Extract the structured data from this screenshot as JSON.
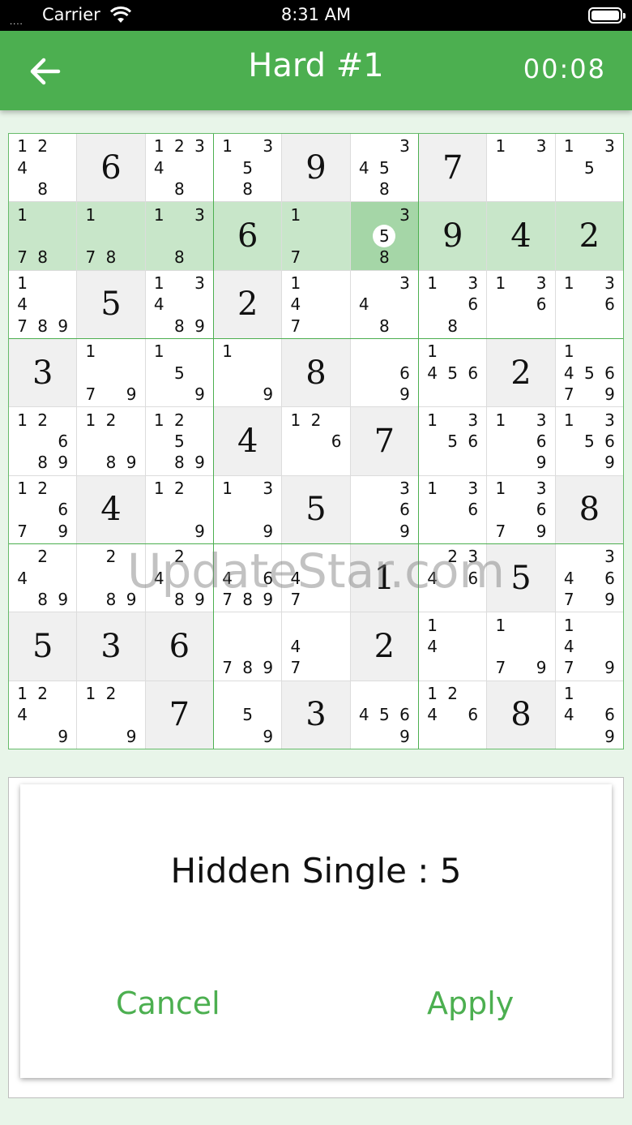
{
  "status_bar": {
    "signal": "....",
    "carrier": "Carrier",
    "time": "8:31 AM"
  },
  "app_bar": {
    "title": "Hard #1",
    "timer": "00:08"
  },
  "board": {
    "cells": [
      [
        {
          "n": "1 2 _ 4 _ _ _ 8 _"
        },
        {
          "v": "6",
          "g": 1
        },
        {
          "n": "1 2 3 4 _ _ _ 8 _"
        },
        {
          "n": "1 _ 3 _ 5 _ _ 8 _"
        },
        {
          "v": "9",
          "g": 1
        },
        {
          "n": "_ _ 3 4 5 _ _ 8 _"
        },
        {
          "v": "7",
          "g": 1
        },
        {
          "n": "1 _ 3 _ _ _ _ _ _"
        },
        {
          "n": "1 _ 3 _ 5 _ _ _ _"
        }
      ],
      [
        {
          "n": "1 _ _ _ _ _ 7 8 _",
          "h": 1
        },
        {
          "n": "1 _ _ _ _ _ 7 8 _",
          "h": 1
        },
        {
          "n": "1 _ 3 _ _ _ _ 8 _",
          "h": 1
        },
        {
          "v": "6",
          "h": 1
        },
        {
          "n": "1 _ _ _ _ _ 7 _ _",
          "h": 1
        },
        {
          "n": "_ _ 3 _ 5 _ _ 8 _",
          "s": 1,
          "m": "5"
        },
        {
          "v": "9",
          "h": 1
        },
        {
          "v": "4",
          "h": 1
        },
        {
          "v": "2",
          "h": 1
        }
      ],
      [
        {
          "n": "1 _ _ 4 _ _ 7 8 9"
        },
        {
          "v": "5",
          "g": 1
        },
        {
          "n": "1 _ 3 4 _ _ _ 8 9"
        },
        {
          "v": "2",
          "g": 1
        },
        {
          "n": "1 _ _ 4 _ _ 7 _ _"
        },
        {
          "n": "_ _ 3 4 _ _ _ 8 _"
        },
        {
          "n": "1 _ 3 _ _ 6 _ 8 _"
        },
        {
          "n": "1 _ 3 _ _ 6 _ _ _"
        },
        {
          "n": "1 _ 3 _ _ 6 _ _ _"
        }
      ],
      [
        {
          "v": "3",
          "g": 1
        },
        {
          "n": "1 _ _ _ _ _ 7 _ 9"
        },
        {
          "n": "1 _ _ _ 5 _ _ _ 9"
        },
        {
          "n": "1 _ _ _ _ _ _ _ 9"
        },
        {
          "v": "8",
          "g": 1
        },
        {
          "n": "_ _ _ _ _ 6 _ _ 9"
        },
        {
          "n": "1 _ _ 4 5 6 _ _ _"
        },
        {
          "v": "2",
          "g": 1
        },
        {
          "n": "1 _ _ 4 5 6 7 _ 9"
        }
      ],
      [
        {
          "n": "1 2 _ _ _ 6 _ 8 9"
        },
        {
          "n": "1 2 _ _ _ _ _ 8 9"
        },
        {
          "n": "1 2 _ _ 5 _ _ 8 9"
        },
        {
          "v": "4",
          "g": 1
        },
        {
          "n": "1 2 _ _ _ 6 _ _ _"
        },
        {
          "v": "7",
          "g": 1
        },
        {
          "n": "1 _ 3 _ 5 6 _ _ _"
        },
        {
          "n": "1 _ 3 _ _ 6 _ _ 9"
        },
        {
          "n": "1 _ 3 _ 5 6 _ _ 9"
        }
      ],
      [
        {
          "n": "1 2 _ _ _ 6 7 _ 9"
        },
        {
          "v": "4",
          "g": 1
        },
        {
          "n": "1 2 _ _ _ _ _ _ 9"
        },
        {
          "n": "1 _ 3 _ _ _ _ _ 9"
        },
        {
          "v": "5",
          "g": 1
        },
        {
          "n": "_ _ 3 _ _ 6 _ _ 9"
        },
        {
          "n": "1 _ 3 _ _ 6 _ _ _"
        },
        {
          "n": "1 _ 3 _ _ 6 7 _ 9"
        },
        {
          "v": "8",
          "g": 1
        }
      ],
      [
        {
          "n": "_ 2 _ 4 _ _ _ 8 9"
        },
        {
          "n": "_ 2 _ _ _ _ _ 8 9"
        },
        {
          "n": "_ 2 _ 4 _ _ _ 8 9"
        },
        {
          "n": "_ _ _ 4 _ 6 7 8 9"
        },
        {
          "n": "_ _ _ 4 _ _ 7 _ _"
        },
        {
          "v": "1",
          "g": 1
        },
        {
          "n": "_ 2 3 4 _ 6 _ _ _"
        },
        {
          "v": "5",
          "g": 1
        },
        {
          "n": "_ _ 3 4 _ 6 7 _ 9"
        }
      ],
      [
        {
          "v": "5",
          "g": 1
        },
        {
          "v": "3",
          "g": 1
        },
        {
          "v": "6",
          "g": 1
        },
        {
          "n": "_ _ _ _ _ _ 7 8 9"
        },
        {
          "n": "_ _ _ 4 _ _ 7 _ _"
        },
        {
          "v": "2",
          "g": 1
        },
        {
          "n": "1 _ _ 4 _ _ _ _ _"
        },
        {
          "n": "1 _ _ _ _ _ 7 _ 9"
        },
        {
          "n": "1 _ _ 4 _ _ 7 _ 9"
        }
      ],
      [
        {
          "n": "1 2 _ 4 _ _ _ _ 9"
        },
        {
          "n": "1 2 _ _ _ _ _ _ 9"
        },
        {
          "v": "7",
          "g": 1
        },
        {
          "n": "_ _ _ _ 5 _ _ _ 9"
        },
        {
          "v": "3",
          "g": 1
        },
        {
          "n": "_ _ _ 4 5 6 _ _ 9"
        },
        {
          "n": "1 2 _ 4 _ 6 _ _ _"
        },
        {
          "v": "8",
          "g": 1
        },
        {
          "n": "1 _ _ 4 _ 6 _ _ 9"
        }
      ]
    ]
  },
  "watermark": "UpdateStar.com",
  "hint": {
    "text": "Hidden Single : 5",
    "cancel_label": "Cancel",
    "apply_label": "Apply"
  },
  "colors": {
    "accent": "#4caf50",
    "highlight": "#c8e6c9",
    "selected": "#a5d6a7"
  }
}
